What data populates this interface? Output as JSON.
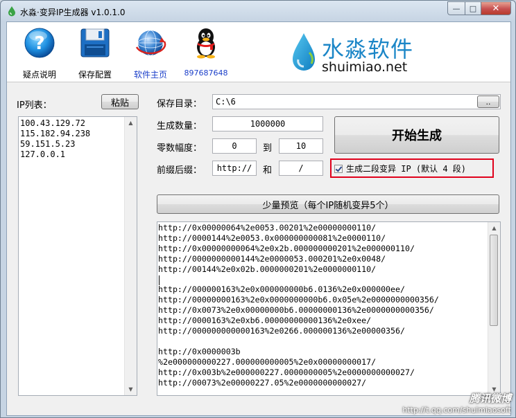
{
  "window": {
    "title": "水淼·变异IP生成器 v1.0.1.0",
    "min_glyph": "—",
    "max_glyph": "□",
    "close_glyph": "✕"
  },
  "toolbar": {
    "help_label": "疑点说明",
    "save_config_label": "保存配置",
    "homepage_label": "软件主页",
    "qq_label": "897687648"
  },
  "brand": {
    "name_cn": "水淼软件",
    "site": "shuimiao.net"
  },
  "ip_panel": {
    "label": "IP列表：",
    "paste_label": "粘贴",
    "ips": [
      "100.43.129.72",
      "115.182.94.238",
      "59.151.5.23",
      "127.0.0.1"
    ]
  },
  "form": {
    "save_dir_label": "保存目录：",
    "save_dir_value": "C:\\6",
    "browse_label": "..",
    "count_label": "生成数量：",
    "count_value": "1000000",
    "zero_range_label": "零数幅度：",
    "zero_min": "0",
    "to_label": "到",
    "zero_max": "10",
    "affix_label": "前缀后缀：",
    "prefix_value": "http://",
    "and_label": "和",
    "suffix_value": "/",
    "start_label": "开始生成",
    "two_segment_label": "生成二段变异 IP (默认 4 段)",
    "two_segment_checked": true
  },
  "preview": {
    "button_label": "少量预览（每个IP随机变异5个）",
    "lines": [
      "http://0x00000064%2e0053.00201%2e00000000110/",
      "http://0000144%2e0053.0x000000000081%2e0000110/",
      "http://0x00000000064%2e0x2b.000000000201%2e000000110/",
      "http://0000000000144%2e0000053.000201%2e0x0048/",
      "http://00144%2e0x02b.0000000201%2e0000000110/",
      "",
      "http://000000163%2e0x000000000b6.0136%2e0x000000ee/",
      "http://00000000163%2e0x0000000000b6.0x05e%2e0000000000356/",
      "http://0x0073%2e0x00000000b6.00000000136%2e0000000000356/",
      "http://0000163%2e0xb6.00000000000136%2e0xee/",
      "http://000000000000163%2e0266.000000136%2e00000356/",
      "",
      "http://0x0000003b",
      "%2e000000000227.000000000005%2e0x00000000017/",
      "http://0x003b%2e000000227.0000000005%2e0000000000027/",
      "http://00073%2e00000227.05%2e0000000000027/"
    ]
  },
  "watermark": {
    "main": "腾讯微博",
    "url": "http://t.qq.com/shuimiaosoft"
  },
  "colors": {
    "brand_blue": "#1b86c7",
    "highlight_red": "#e0001b",
    "link_blue": "#1a3ec9"
  }
}
